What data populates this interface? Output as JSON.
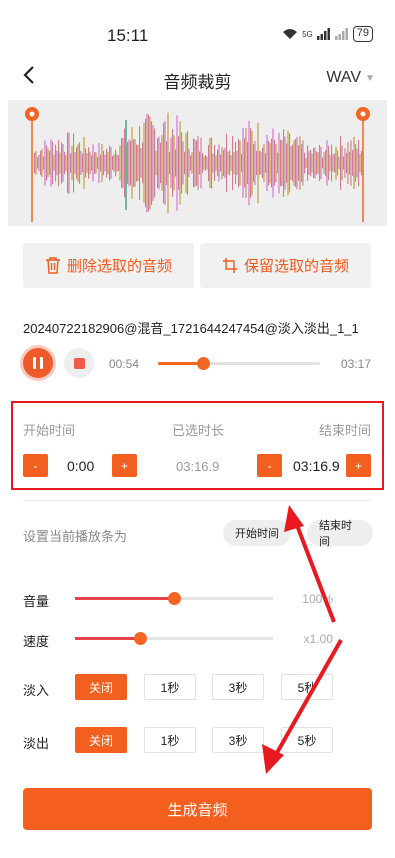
{
  "status": {
    "time": "15:11",
    "battery": "79",
    "network": "5G"
  },
  "header": {
    "back_icon": "back-arrow-icon",
    "title": "音频裁剪",
    "format": "WAV"
  },
  "actions": {
    "delete_label": "删除选取的音频",
    "keep_label": "保留选取的音频"
  },
  "file": {
    "name": "20240722182906@混音_1721644247454@淡入淡出_1_1"
  },
  "player": {
    "current": "00:54",
    "total": "03:17",
    "progress": 0.28
  },
  "range": {
    "start_label": "开始时间",
    "duration_label": "已选时长",
    "end_label": "结束时间",
    "minus": "-",
    "plus": "+",
    "start_value": "0:00",
    "duration_value": "03:16.9",
    "end_value": "03:16.9"
  },
  "set_playhead": {
    "label": "设置当前播放条为",
    "start_btn": "开始时间",
    "end_btn": "结束时间"
  },
  "volume": {
    "label": "音量",
    "value": "100%",
    "level": 0.5
  },
  "speed": {
    "label": "速度",
    "value": "x1.00",
    "level": 0.33
  },
  "fade_in": {
    "label": "淡入",
    "options": [
      "关闭",
      "1秒",
      "3秒",
      "5秒"
    ],
    "selected": "关闭"
  },
  "fade_out": {
    "label": "淡出",
    "options": [
      "关闭",
      "1秒",
      "3秒",
      "5秒"
    ],
    "selected": "关闭"
  },
  "generate_label": "生成音频",
  "colors": {
    "accent": "#f55f1e",
    "annotation": "#e8191f"
  }
}
